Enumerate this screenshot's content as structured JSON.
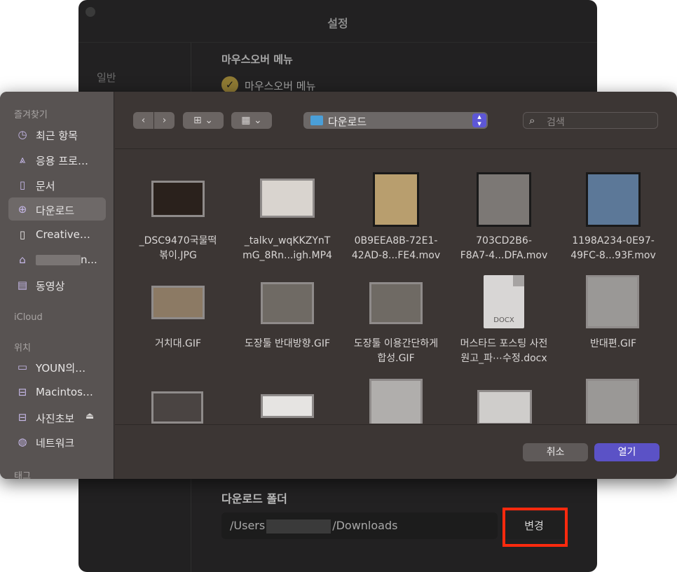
{
  "settings": {
    "title": "설정",
    "sidebar_item": "일반",
    "mouseover_heading": "마우스오버 메뉴",
    "mouseover_checkbox_label": "마우스오버 메뉴",
    "download_folder_heading": "다운로드 폴더",
    "path_prefix": "/Users",
    "path_suffix": "/Downloads",
    "change_button": "변경"
  },
  "dialog": {
    "sidebar": {
      "favorites_heading": "즐겨찾기",
      "favorites": [
        {
          "label": "최근 항목",
          "icon": "clock-icon"
        },
        {
          "label": "응용 프로…",
          "icon": "applications-icon"
        },
        {
          "label": "문서",
          "icon": "document-icon"
        },
        {
          "label": "다운로드",
          "icon": "download-icon"
        },
        {
          "label": "Creative…",
          "icon": "file-icon"
        },
        {
          "label": "n...",
          "icon": "home-icon"
        },
        {
          "label": "동영상",
          "icon": "film-icon"
        }
      ],
      "icloud_heading": "iCloud",
      "locations_heading": "위치",
      "locations": [
        {
          "label": "YOUN의…",
          "icon": "computer-icon"
        },
        {
          "label": "Macintos…",
          "icon": "disk-icon"
        },
        {
          "label": "사진초보",
          "icon": "disk-icon"
        },
        {
          "label": "네트워크",
          "icon": "network-icon"
        }
      ],
      "tags_heading": "태그"
    },
    "toolbar": {
      "location": "다운로드",
      "search_placeholder": "검색"
    },
    "files": [
      {
        "line1": "_DSC9470국물떡",
        "line2": "볶이.JPG"
      },
      {
        "line1": "_talkv_wqKKZYnT",
        "line2": "mG_8Rn...igh.MP4"
      },
      {
        "line1": "0B9EEA8B-72E1-",
        "line2": "42AD-8...FE4.mov"
      },
      {
        "line1": "703CD2B6-",
        "line2": "F8A7-4...DFA.mov"
      },
      {
        "line1": "1198A234-0E97-",
        "line2": "49FC-8...93F.mov"
      },
      {
        "line1": "거치대.GIF",
        "line2": ""
      },
      {
        "line1": "도장툴 반대방향.GIF",
        "line2": ""
      },
      {
        "line1": "도장툴 이용간단하게",
        "line2": "합성.GIF"
      },
      {
        "line1": "머스타드 포스팅 사전",
        "line2": "원고_파⋯수정.docx"
      },
      {
        "line1": "반대편.GIF",
        "line2": ""
      }
    ],
    "docx_label": "DOCX",
    "cancel_button": "취소",
    "open_button": "열기"
  },
  "colors": {
    "accent": "#5b52c6",
    "highlight": "#ff2a0e",
    "folder": "#4a9fd8"
  }
}
